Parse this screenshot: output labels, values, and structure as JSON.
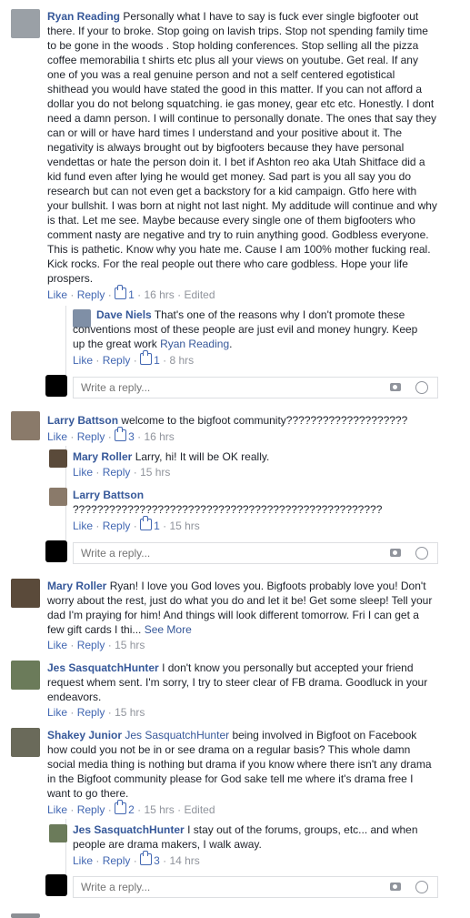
{
  "ui": {
    "like": "Like",
    "reply": "Reply",
    "dot": "·",
    "reply_placeholder": "Write a reply...",
    "see_more": "See More",
    "edited": "Edited"
  },
  "comments": [
    {
      "name": "Ryan Reading",
      "text": "Personally what I have to say is fuck ever single bigfooter out there. If your to broke. Stop going on lavish trips. Stop not spending family time to be gone in the woods . Stop holding conferences. Stop selling all the pizza coffee memorabilia t shirts etc plus all your views on youtube. Get real. If any one of you was a real genuine person and not a self centered egotistical shithead you would have stated the good in this matter. If you can not afford a dollar you do not belong squatching. ie gas money, gear etc etc. Honestly. I dont need a damn person. I will continue to personally donate. The ones that say they can or will or have hard times I understand and your positive about it. The negativity is always brought out by bigfooters because they have personal vendettas or hate the person doin it. I bet if Ashton reo aka Utah Shitface did a kid fund even after lying he would get money. Sad part is you all say you do research but can not even get a backstory for a kid campaign. Gtfo here with your bullshit. I was born at night not last night. My additude will continue and why is that. Let me see. Maybe because every single one of them bigfooters who comment nasty are negative and try to ruin anything good. Godbless everyone. This is pathetic. Know why you hate me. Cause I am 100% mother fucking real. Kick rocks. For the real people out there who care godbless. Hope your life prospers.",
      "likes": "1",
      "time": "16 hrs"
    },
    {
      "name": "Dave Niels",
      "text": "That's one of the reasons why I don't promote these conventions most of these people are just evil and money hungry. Keep up the great work",
      "mention": "Ryan Reading",
      "likes": "1",
      "time": "8 hrs"
    },
    {
      "name": "Larry Battson",
      "text": "welcome to the bigfoot community????????????????????",
      "likes": "3",
      "time": "16 hrs"
    },
    {
      "name": "Mary Roller",
      "text": "Larry, hi! It will be OK really.",
      "time": "15 hrs"
    },
    {
      "name": "Larry Battson",
      "text": "???????????????????????????????????????????????????",
      "likes": "1",
      "time": "15 hrs"
    },
    {
      "name": "Mary Roller",
      "text": "Ryan! I love you God loves you. Bigfoots probably love you! Don't worry about the rest, just do what you do and let it be! Get some sleep! Tell your dad I'm praying for him! And things will look different tomorrow. Fri I can get a few gift cards I thi...",
      "time": "15 hrs"
    },
    {
      "name": "Jes SasquatchHunter",
      "text": "I don't know you personally but accepted your friend request whem sent. I'm sorry, I try to steer clear of FB drama. Goodluck in your endeavors.",
      "time": "15 hrs"
    },
    {
      "name": "Shakey Junior",
      "mention": "Jes SasquatchHunter",
      "text": "being involved in Bigfoot on Facebook how could you not be in or see drama on a regular basis? This whole damn social media thing is nothing but drama if you know where there isn't any drama in the Bigfoot community please for God sake tell me where it's drama free I want to go there.",
      "likes": "2",
      "time": "15 hrs"
    },
    {
      "name": "Jes SasquatchHunter",
      "text": "I stay out of the forums, groups, etc... and when people are drama makers, I walk away.",
      "likes": "3",
      "time": "14 hrs"
    }
  ],
  "colors": {
    "link": "#365899",
    "action": "#4267b2",
    "meta": "#90949c",
    "border": "#dddfe2"
  }
}
